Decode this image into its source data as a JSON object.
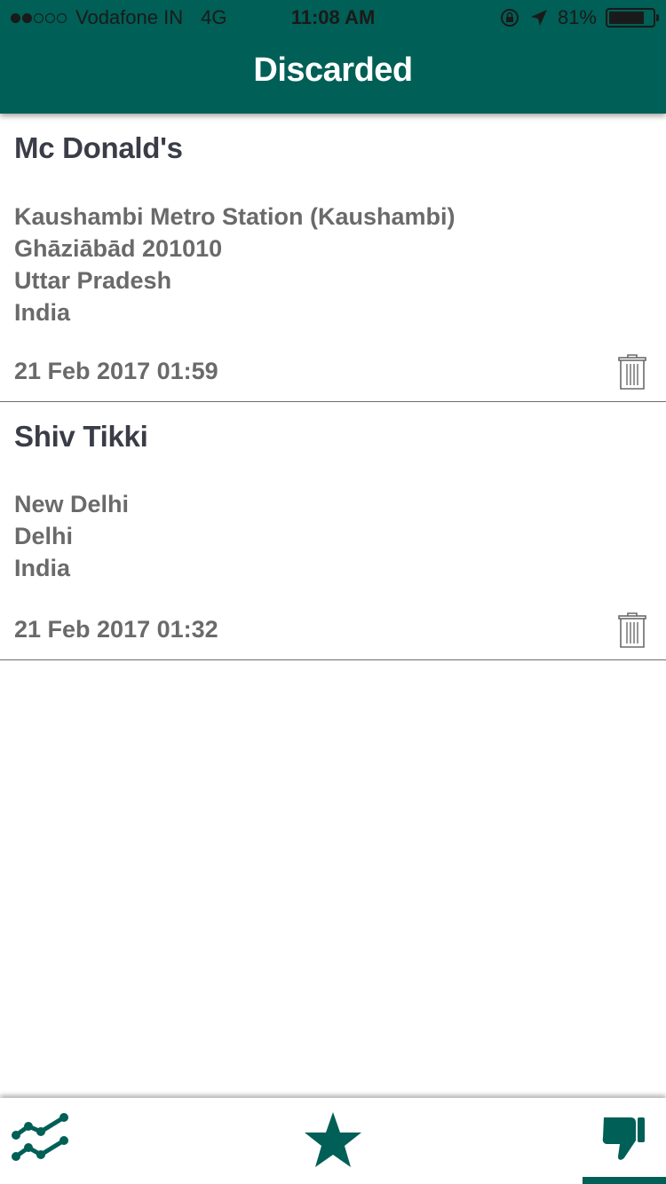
{
  "status_bar": {
    "carrier": "Vodafone IN",
    "network": "4G",
    "time": "11:08 AM",
    "battery": "81%",
    "battery_level": 0.81,
    "signal_bars_filled": 2,
    "signal_bars_total": 5,
    "icons": [
      "orientation-lock-icon",
      "location-arrow-icon",
      "battery-icon"
    ]
  },
  "header": {
    "title": "Discarded"
  },
  "items": [
    {
      "name": "Mc Donald's",
      "address_lines": [
        "Kaushambi Metro Station (Kaushambi)",
        "Ghāziābād 201010",
        "Uttar Pradesh",
        "India"
      ],
      "date": "21 Feb 2017 01:59",
      "icon": "trash-icon"
    },
    {
      "name": "Shiv Tikki",
      "address_lines": [
        "New Delhi",
        "Delhi",
        "India"
      ],
      "date": "21 Feb 2017 01:32",
      "icon": "trash-icon"
    }
  ],
  "tabbar": {
    "tabs": [
      {
        "name": "trending",
        "icon": "trend-lines-icon"
      },
      {
        "name": "favorites",
        "icon": "star-icon"
      },
      {
        "name": "discarded",
        "icon": "thumbs-down-icon",
        "selected": true
      }
    ]
  },
  "colors": {
    "primary": "#005f56",
    "title_text": "#3a3d47",
    "body_text": "#6a6a6a"
  }
}
